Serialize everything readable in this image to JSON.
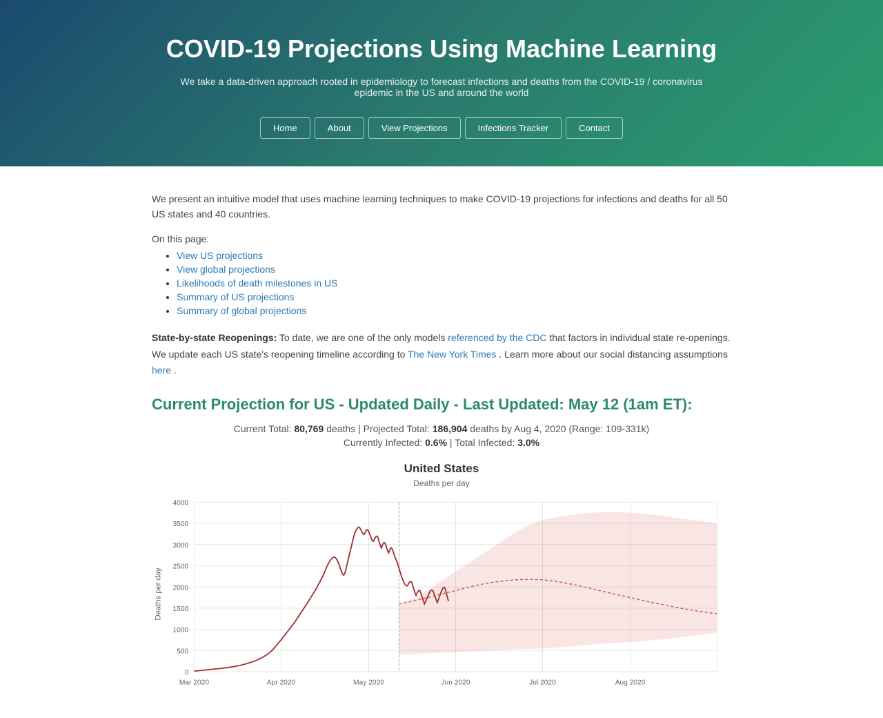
{
  "header": {
    "title": "COVID-19 Projections Using Machine Learning",
    "subtitle": "We take a data-driven approach rooted in epidemiology to forecast infections and deaths from the COVID-19 / coronavirus epidemic in the US and around the world",
    "nav": [
      {
        "label": "Home",
        "id": "home"
      },
      {
        "label": "About",
        "id": "about"
      },
      {
        "label": "View Projections",
        "id": "view-projections"
      },
      {
        "label": "Infections Tracker",
        "id": "infections-tracker"
      },
      {
        "label": "Contact",
        "id": "contact"
      }
    ]
  },
  "intro": {
    "paragraph": "We present an intuitive model that uses machine learning techniques to make COVID-19 projections for infections and deaths for all 50 US states and 40 countries.",
    "on_this_page": "On this page:",
    "links": [
      {
        "text": "View US projections",
        "href": "#"
      },
      {
        "text": "View global projections",
        "href": "#"
      },
      {
        "text": "Likelihoods of death milestones in US",
        "href": "#"
      },
      {
        "text": "Summary of US projections",
        "href": "#"
      },
      {
        "text": "Summary of global projections",
        "href": "#"
      }
    ],
    "reopening_label": "State-by-state Reopenings:",
    "reopening_text1": " To date, we are one of the only models ",
    "reopening_link1": "referenced by the CDC",
    "reopening_text2": " that factors in individual state re-openings. We update each US state's reopening timeline according to ",
    "reopening_link2": "The New York Times",
    "reopening_text3": ". Learn more about our social distancing assumptions ",
    "reopening_link3": "here",
    "reopening_text4": "."
  },
  "projection": {
    "section_title": "Current Projection for US - Updated Daily - Last Updated: May 12 (1am ET):",
    "stats_line1_pre": "Current Total: ",
    "current_total": "80,769",
    "stats_line1_mid": " deaths  |  Projected Total: ",
    "projected_total": "186,904",
    "stats_line1_post": " deaths by Aug 4, 2020 (Range: 109-331k)",
    "stats_line2_pre": "Currently Infected: ",
    "currently_infected": "0.6%",
    "stats_line2_mid": "  |  Total Infected: ",
    "total_infected": "3.0%",
    "chart_title": "United States",
    "chart_subtitle": "Deaths per day",
    "y_axis_label": "Deaths per day",
    "x_labels": [
      "Mar 2020",
      "Apr 2020",
      "May 2020",
      "Jun 2020",
      "Jul 2020",
      "Aug 2020"
    ],
    "y_labels": [
      "0",
      "500",
      "1000",
      "1500",
      "2000",
      "2500",
      "3000",
      "3500",
      "4000"
    ]
  }
}
